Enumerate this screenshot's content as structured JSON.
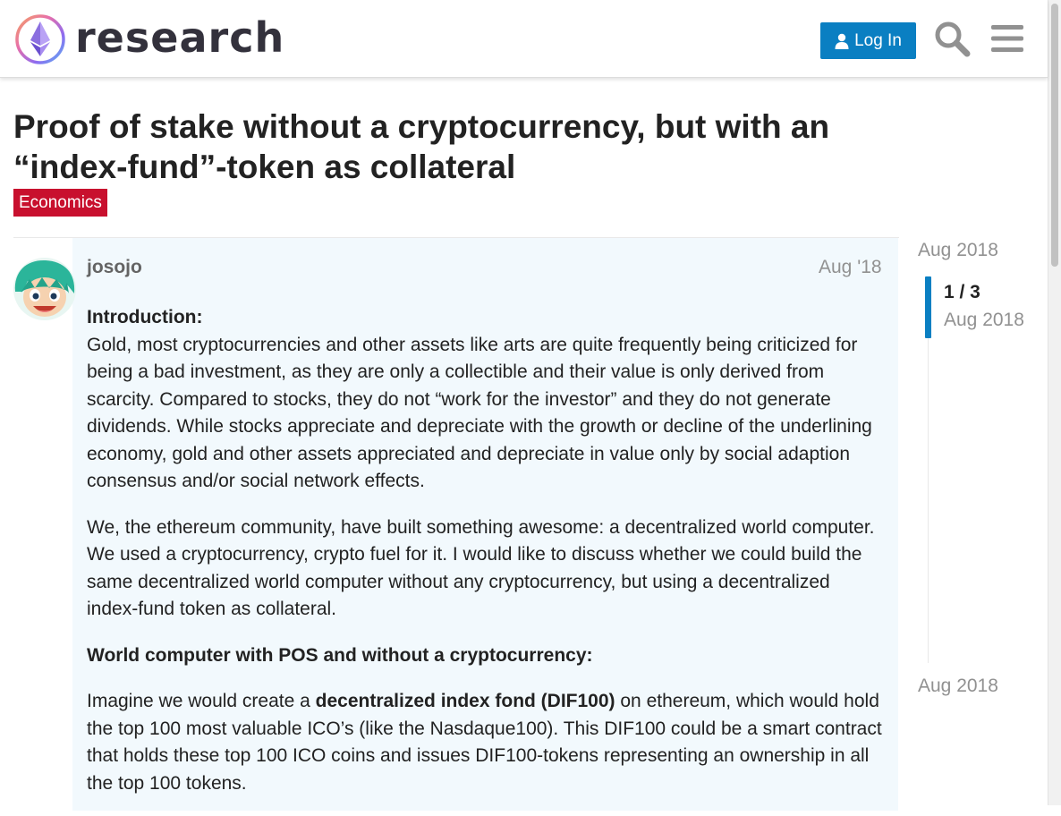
{
  "site": {
    "logo_text": "research",
    "login_label": "Log In",
    "search_icon": "search-icon",
    "menu_icon": "hamburger-menu-icon"
  },
  "topic": {
    "title": "Proof of stake without a cryptocurrency, but with an “index-fund”-token as collateral",
    "category": "Economics",
    "category_color": "#c8102e"
  },
  "post": {
    "username": "josojo",
    "date": "Aug '18",
    "intro_heading": "Introduction:",
    "p1": "Gold, most cryptocurrencies and other assets like arts are quite frequently being criticized for being a bad investment, as they are only a collectible and their value is only derived from scarcity. Compared to stocks, they do not “work for the investor” and they do not generate dividends. While stocks appreciate and depreciate with the growth or decline of the underlining economy, gold and other assets appreciated and depreciate in value only by social adaption consensus and/or social network effects.",
    "p2": "We, the ethereum community, have built something awesome: a decentralized world computer. We used a cryptocurrency, crypto fuel for it. I would like to discuss whether we could build the same decentralized world computer without any cryptocurrency, but using a decentralized index-fund token as collateral.",
    "heading2": "World computer with POS and without a cryptocurrency:",
    "p3_pre": "Imagine we would create a ",
    "p3_bold": "decentralized index fond (DIF100)",
    "p3_post": " on ethereum, which would hold the top 100 most valuable ICO’s (like the Nasdaque100). This DIF100 could be a smart contract that holds these top 100 ICO coins and issues DIF100-tokens representing an ownership in all the top 100 tokens."
  },
  "timeline": {
    "start_date": "Aug 2018",
    "position": "1 / 3",
    "current_date": "Aug 2018",
    "end_date": "Aug 2018"
  },
  "colors": {
    "accent": "#0a7fc2",
    "post_highlight": "#f2f9fd"
  }
}
